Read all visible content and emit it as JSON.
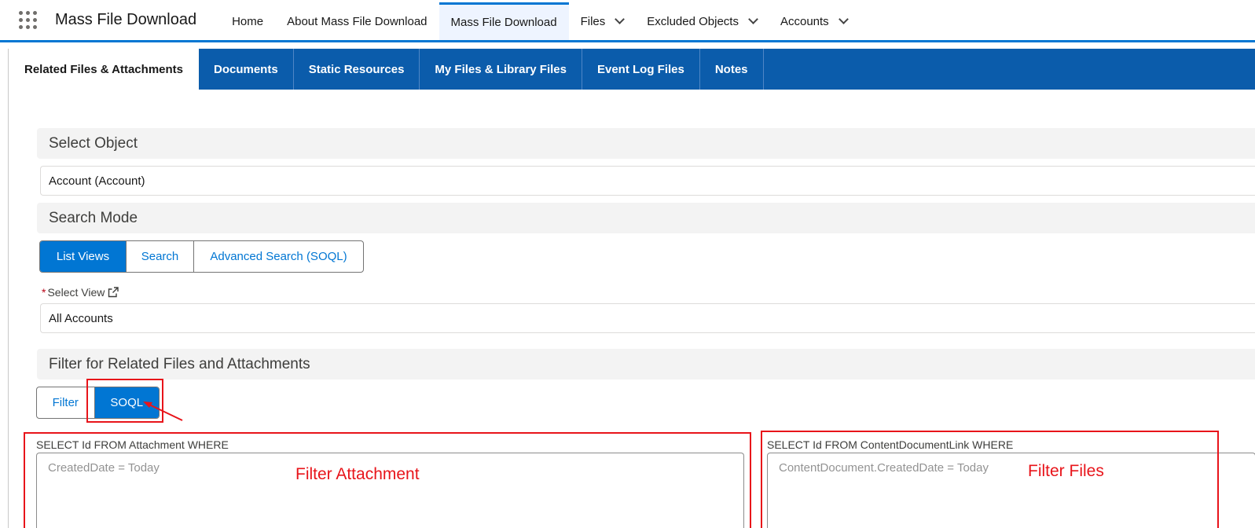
{
  "header": {
    "app_name": "Mass File Download",
    "nav": [
      {
        "label": "Home"
      },
      {
        "label": "About Mass File Download"
      },
      {
        "label": "Mass File Download"
      },
      {
        "label": "Files"
      },
      {
        "label": "Excluded Objects"
      },
      {
        "label": "Accounts"
      }
    ],
    "active_nav": "Mass File Download"
  },
  "tabs": [
    {
      "label": "Related Files & Attachments"
    },
    {
      "label": "Documents"
    },
    {
      "label": "Static Resources"
    },
    {
      "label": "My Files & Library Files"
    },
    {
      "label": "Event Log Files"
    },
    {
      "label": "Notes"
    }
  ],
  "active_tab": "Related Files & Attachments",
  "select_object": {
    "heading": "Select Object",
    "value": "Account (Account)"
  },
  "search_mode": {
    "heading": "Search Mode",
    "options": [
      "List Views",
      "Search",
      "Advanced Search (SOQL)"
    ],
    "selected": "List Views"
  },
  "select_view": {
    "required_marker": "*",
    "label": "Select View",
    "value": "All Accounts"
  },
  "filter_section": {
    "heading": "Filter for Related Files and Attachments",
    "options": [
      "Filter",
      "SOQL"
    ],
    "selected": "SOQL"
  },
  "attachment_query": {
    "prefix": "SELECT Id FROM Attachment WHERE",
    "placeholder": "CreatedDate = Today",
    "annotation": "Filter Attachment"
  },
  "files_query": {
    "prefix": "SELECT Id FROM ContentDocumentLink WHERE",
    "placeholder": "ContentDocument.CreatedDate = Today",
    "annotation": "Filter Files"
  },
  "colors": {
    "brand": "#0176d3",
    "tab_bar": "#0b5cab",
    "annotation": "#e8141a"
  }
}
